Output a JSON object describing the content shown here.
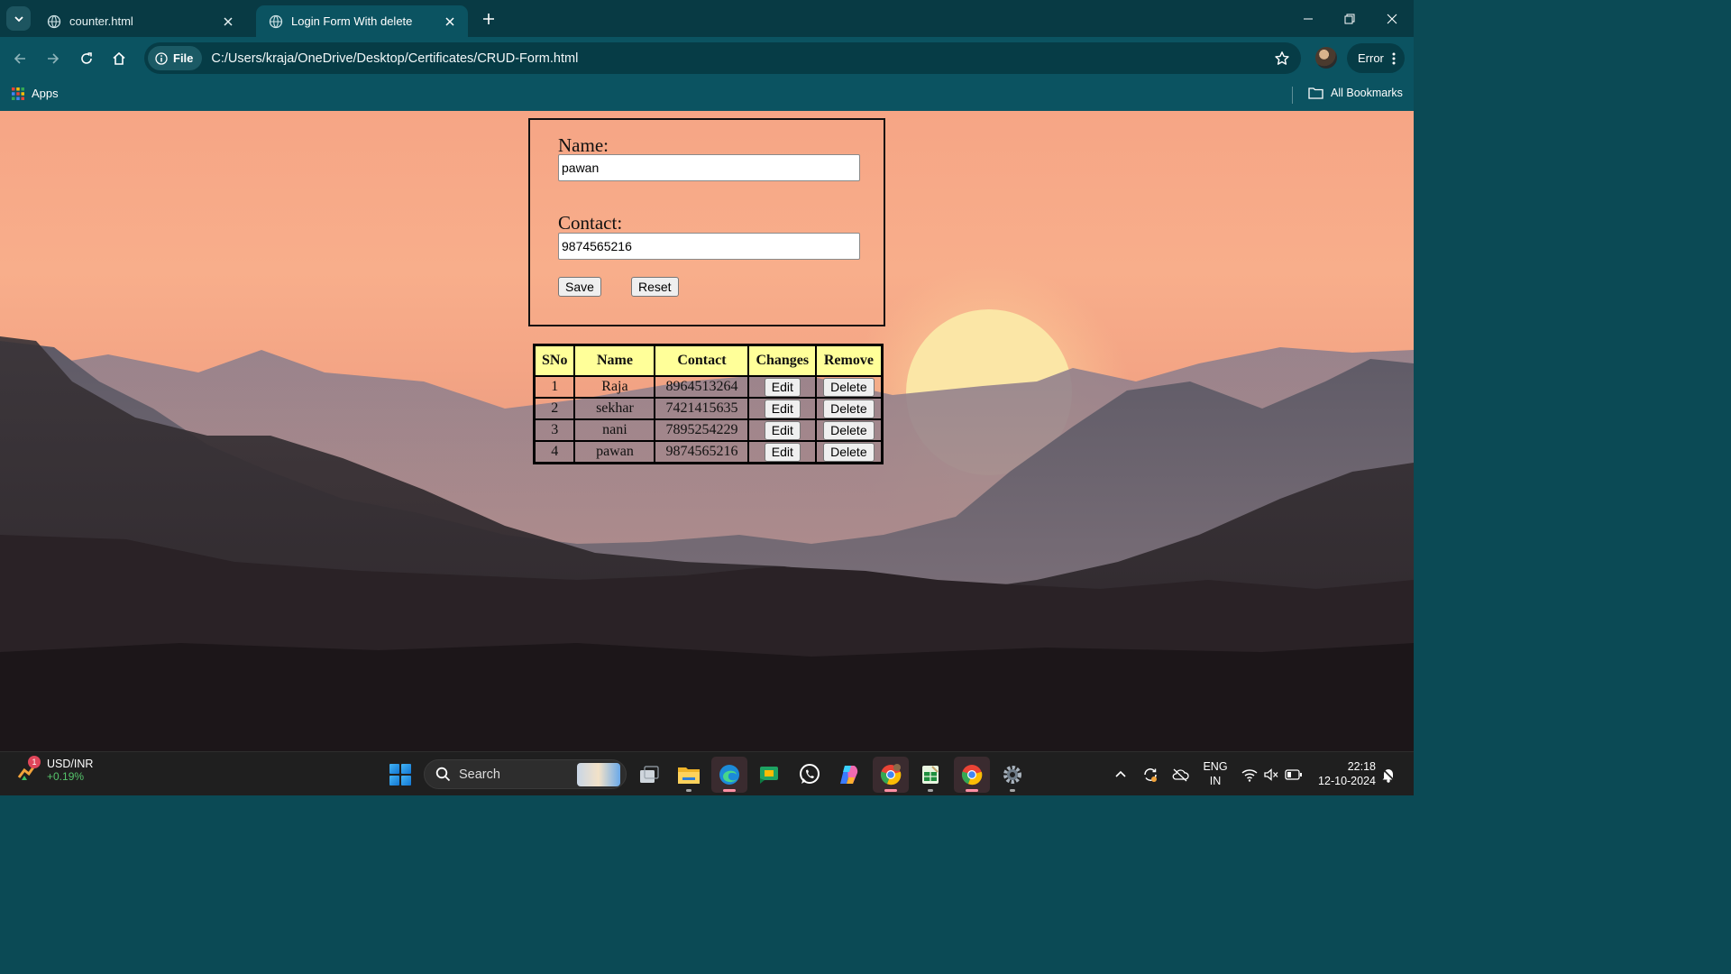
{
  "browser": {
    "tabs": [
      {
        "title": "counter.html",
        "active": false
      },
      {
        "title": "Login Form With delete",
        "active": true
      }
    ],
    "address": {
      "chip_label": "File",
      "url": "C:/Users/kraja/OneDrive/Desktop/Certificates/CRUD-Form.html"
    },
    "profile_status": "Error",
    "bookmarks": {
      "apps_label": "Apps",
      "all_bookmarks_label": "All Bookmarks"
    }
  },
  "form": {
    "name_label": "Name:",
    "name_value": "pawan",
    "contact_label": "Contact:",
    "contact_value": "9874565216",
    "save_label": "Save",
    "reset_label": "Reset"
  },
  "table": {
    "headers": [
      "SNo",
      "Name",
      "Contact",
      "Changes",
      "Remove"
    ],
    "edit_label": "Edit",
    "delete_label": "Delete",
    "rows": [
      {
        "sno": "1",
        "name": "Raja",
        "contact": "8964513264"
      },
      {
        "sno": "2",
        "name": "sekhar",
        "contact": "7421415635"
      },
      {
        "sno": "3",
        "name": "nani",
        "contact": "7895254229"
      },
      {
        "sno": "4",
        "name": "pawan",
        "contact": "9874565216"
      }
    ]
  },
  "taskbar": {
    "widget": {
      "title": "USD/INR",
      "change": "+0.19%",
      "badge": "1"
    },
    "search_placeholder": "Search",
    "apps": [
      "task-view",
      "file-explorer",
      "edge",
      "google-chat",
      "whatsapp",
      "copilot",
      "chrome-profile",
      "sheets-editor",
      "chrome",
      "settings"
    ],
    "language": {
      "line1": "ENG",
      "line2": "IN"
    },
    "clock": {
      "time": "22:18",
      "date": "12-10-2024"
    }
  },
  "colors": {
    "tab_bar": "#083a44",
    "toolbar": "#0b5361",
    "table_header_bg": "#ffff99",
    "taskbar": "#1f1f1f"
  }
}
